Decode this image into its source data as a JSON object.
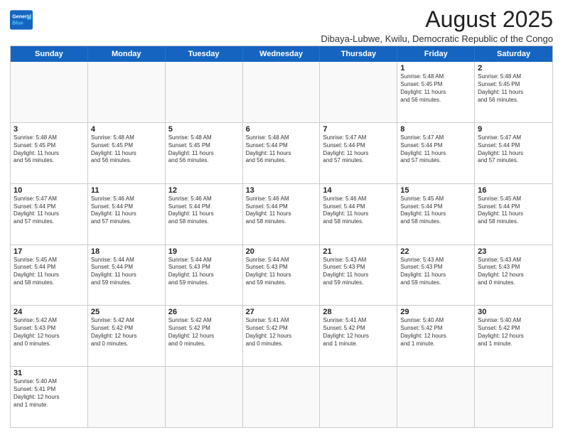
{
  "header": {
    "logo_general": "General",
    "logo_blue": "Blue",
    "main_title": "August 2025",
    "subtitle": "Dibaya-Lubwe, Kwilu, Democratic Republic of the Congo"
  },
  "weekdays": [
    "Sunday",
    "Monday",
    "Tuesday",
    "Wednesday",
    "Thursday",
    "Friday",
    "Saturday"
  ],
  "rows": [
    [
      {
        "day": "",
        "info": ""
      },
      {
        "day": "",
        "info": ""
      },
      {
        "day": "",
        "info": ""
      },
      {
        "day": "",
        "info": ""
      },
      {
        "day": "",
        "info": ""
      },
      {
        "day": "1",
        "info": "Sunrise: 5:48 AM\nSunset: 5:45 PM\nDaylight: 11 hours\nand 56 minutes."
      },
      {
        "day": "2",
        "info": "Sunrise: 5:48 AM\nSunset: 5:45 PM\nDaylight: 11 hours\nand 56 minutes."
      }
    ],
    [
      {
        "day": "3",
        "info": "Sunrise: 5:48 AM\nSunset: 5:45 PM\nDaylight: 11 hours\nand 56 minutes."
      },
      {
        "day": "4",
        "info": "Sunrise: 5:48 AM\nSunset: 5:45 PM\nDaylight: 11 hours\nand 56 minutes."
      },
      {
        "day": "5",
        "info": "Sunrise: 5:48 AM\nSunset: 5:45 PM\nDaylight: 11 hours\nand 56 minutes."
      },
      {
        "day": "6",
        "info": "Sunrise: 5:48 AM\nSunset: 5:44 PM\nDaylight: 11 hours\nand 56 minutes."
      },
      {
        "day": "7",
        "info": "Sunrise: 5:47 AM\nSunset: 5:44 PM\nDaylight: 11 hours\nand 57 minutes."
      },
      {
        "day": "8",
        "info": "Sunrise: 5:47 AM\nSunset: 5:44 PM\nDaylight: 11 hours\nand 57 minutes."
      },
      {
        "day": "9",
        "info": "Sunrise: 5:47 AM\nSunset: 5:44 PM\nDaylight: 11 hours\nand 57 minutes."
      }
    ],
    [
      {
        "day": "10",
        "info": "Sunrise: 5:47 AM\nSunset: 5:44 PM\nDaylight: 11 hours\nand 57 minutes."
      },
      {
        "day": "11",
        "info": "Sunrise: 5:46 AM\nSunset: 5:44 PM\nDaylight: 11 hours\nand 57 minutes."
      },
      {
        "day": "12",
        "info": "Sunrise: 5:46 AM\nSunset: 5:44 PM\nDaylight: 11 hours\nand 58 minutes."
      },
      {
        "day": "13",
        "info": "Sunrise: 5:46 AM\nSunset: 5:44 PM\nDaylight: 11 hours\nand 58 minutes."
      },
      {
        "day": "14",
        "info": "Sunrise: 5:46 AM\nSunset: 5:44 PM\nDaylight: 11 hours\nand 58 minutes."
      },
      {
        "day": "15",
        "info": "Sunrise: 5:45 AM\nSunset: 5:44 PM\nDaylight: 11 hours\nand 58 minutes."
      },
      {
        "day": "16",
        "info": "Sunrise: 5:45 AM\nSunset: 5:44 PM\nDaylight: 11 hours\nand 58 minutes."
      }
    ],
    [
      {
        "day": "17",
        "info": "Sunrise: 5:45 AM\nSunset: 5:44 PM\nDaylight: 11 hours\nand 58 minutes."
      },
      {
        "day": "18",
        "info": "Sunrise: 5:44 AM\nSunset: 5:44 PM\nDaylight: 11 hours\nand 59 minutes."
      },
      {
        "day": "19",
        "info": "Sunrise: 5:44 AM\nSunset: 5:43 PM\nDaylight: 11 hours\nand 59 minutes."
      },
      {
        "day": "20",
        "info": "Sunrise: 5:44 AM\nSunset: 5:43 PM\nDaylight: 11 hours\nand 59 minutes."
      },
      {
        "day": "21",
        "info": "Sunrise: 5:43 AM\nSunset: 5:43 PM\nDaylight: 11 hours\nand 59 minutes."
      },
      {
        "day": "22",
        "info": "Sunrise: 5:43 AM\nSunset: 5:43 PM\nDaylight: 11 hours\nand 59 minutes."
      },
      {
        "day": "23",
        "info": "Sunrise: 5:43 AM\nSunset: 5:43 PM\nDaylight: 12 hours\nand 0 minutes."
      }
    ],
    [
      {
        "day": "24",
        "info": "Sunrise: 5:42 AM\nSunset: 5:43 PM\nDaylight: 12 hours\nand 0 minutes."
      },
      {
        "day": "25",
        "info": "Sunrise: 5:42 AM\nSunset: 5:42 PM\nDaylight: 12 hours\nand 0 minutes."
      },
      {
        "day": "26",
        "info": "Sunrise: 5:42 AM\nSunset: 5:42 PM\nDaylight: 12 hours\nand 0 minutes."
      },
      {
        "day": "27",
        "info": "Sunrise: 5:41 AM\nSunset: 5:42 PM\nDaylight: 12 hours\nand 0 minutes."
      },
      {
        "day": "28",
        "info": "Sunrise: 5:41 AM\nSunset: 5:42 PM\nDaylight: 12 hours\nand 1 minute."
      },
      {
        "day": "29",
        "info": "Sunrise: 5:40 AM\nSunset: 5:42 PM\nDaylight: 12 hours\nand 1 minute."
      },
      {
        "day": "30",
        "info": "Sunrise: 5:40 AM\nSunset: 5:42 PM\nDaylight: 12 hours\nand 1 minute."
      }
    ],
    [
      {
        "day": "31",
        "info": "Sunrise: 5:40 AM\nSunset: 5:41 PM\nDaylight: 12 hours\nand 1 minute."
      },
      {
        "day": "",
        "info": ""
      },
      {
        "day": "",
        "info": ""
      },
      {
        "day": "",
        "info": ""
      },
      {
        "day": "",
        "info": ""
      },
      {
        "day": "",
        "info": ""
      },
      {
        "day": "",
        "info": ""
      }
    ]
  ]
}
